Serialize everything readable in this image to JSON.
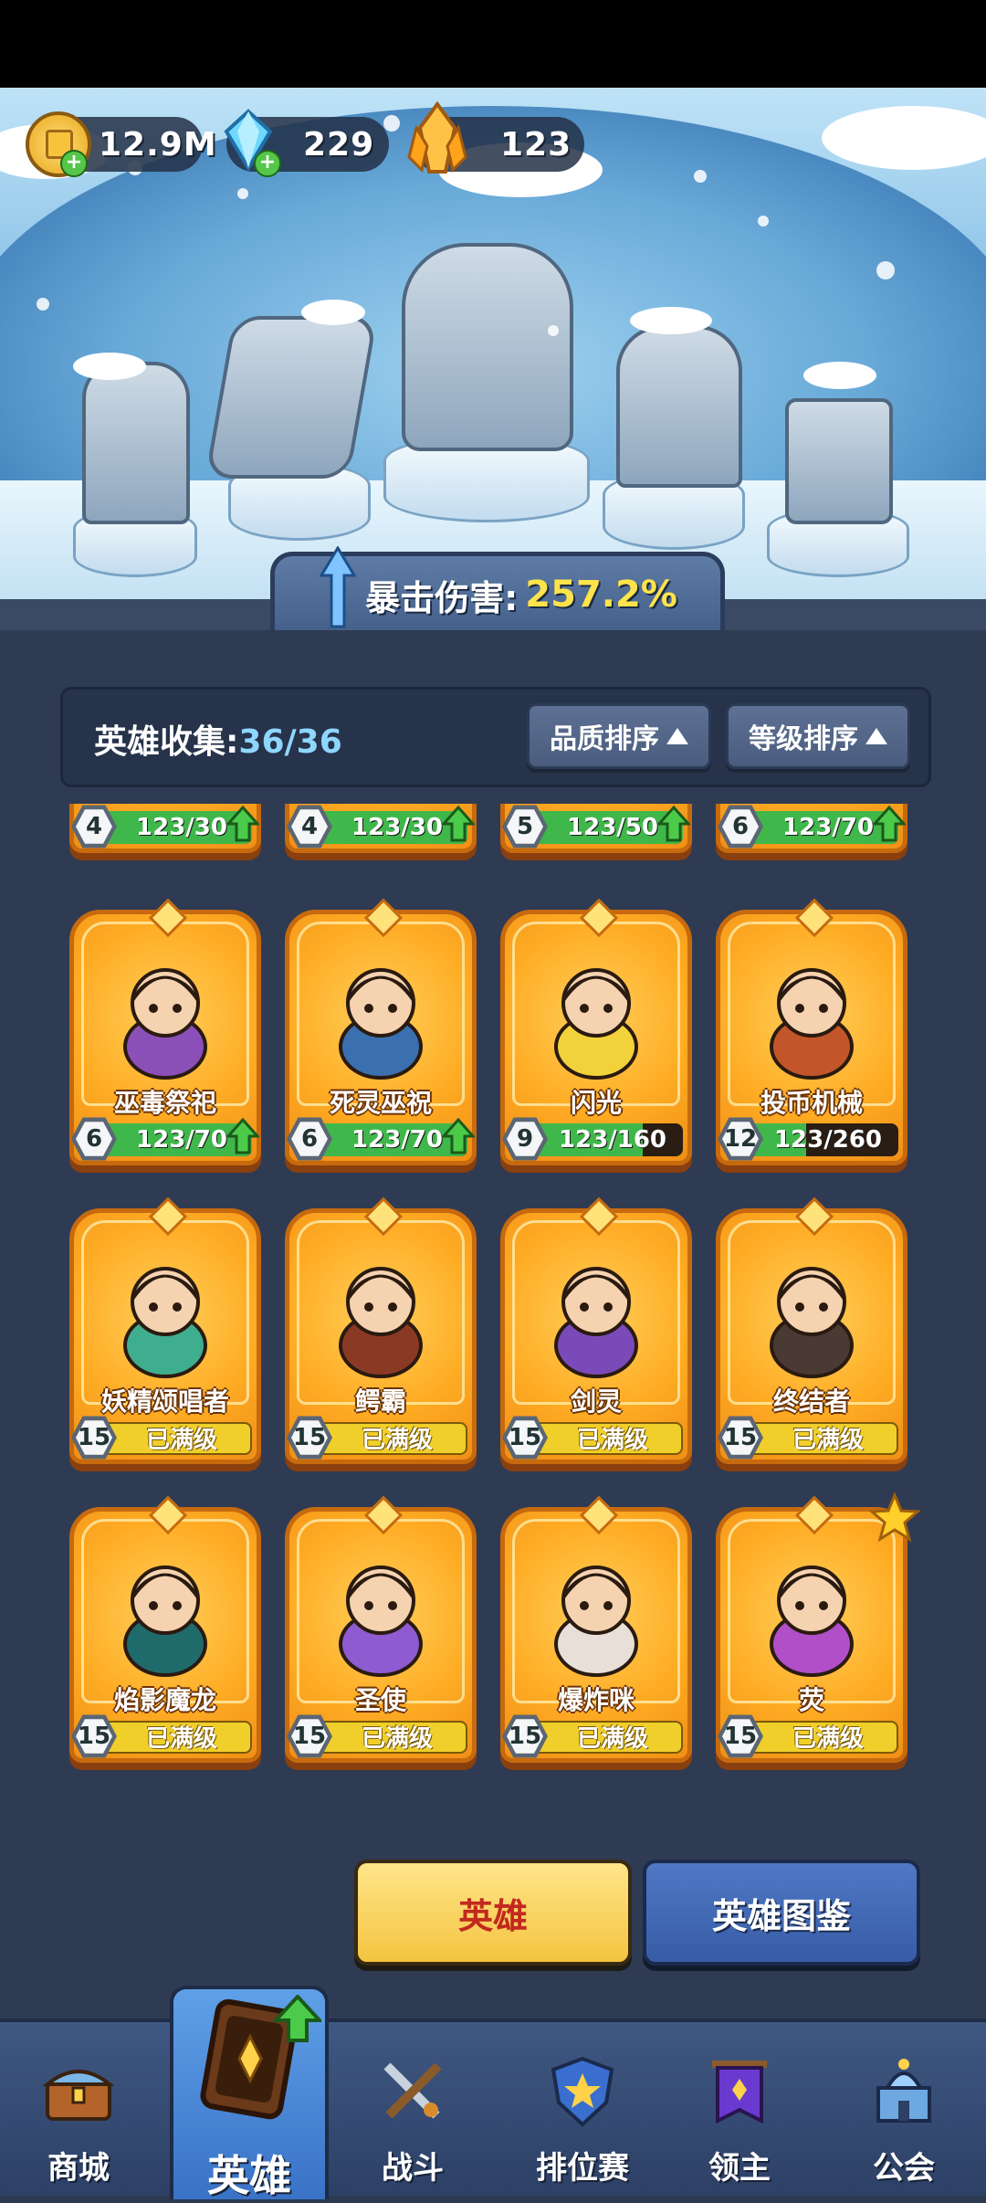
{
  "resources": {
    "gold": "12.9M",
    "diamonds": "229",
    "crystals": "123"
  },
  "crit_banner": {
    "label": "暴击伤害:",
    "value": "257.2%"
  },
  "collection": {
    "label": "英雄收集:",
    "count": "36/36",
    "sort_quality": "品质排序",
    "sort_level": "等级排序"
  },
  "heroes_partial": [
    {
      "level": "4",
      "progress": "123/30",
      "fill": 1.0
    },
    {
      "level": "4",
      "progress": "123/30",
      "fill": 1.0
    },
    {
      "level": "5",
      "progress": "123/50",
      "fill": 1.0
    },
    {
      "level": "6",
      "progress": "123/70",
      "fill": 1.0
    }
  ],
  "heroes": [
    {
      "name": "巫毒祭祀",
      "level": "6",
      "progress": "123/70",
      "fill": 1.0,
      "upgradable": true,
      "color": "#8b4fb8"
    },
    {
      "name": "死灵巫祝",
      "level": "6",
      "progress": "123/70",
      "fill": 1.0,
      "upgradable": true,
      "color": "#3a6fb0"
    },
    {
      "name": "闪光",
      "level": "9",
      "progress": "123/160",
      "fill": 0.77,
      "upgradable": false,
      "color": "#f2d23a"
    },
    {
      "name": "投币机械",
      "level": "12",
      "progress": "123/260",
      "fill": 0.47,
      "upgradable": false,
      "color": "#c2562a"
    },
    {
      "name": "妖精颂唱者",
      "level": "15",
      "progress": "已满级",
      "maxed": true,
      "color": "#3fae8e"
    },
    {
      "name": "鳄霸",
      "level": "15",
      "progress": "已满级",
      "maxed": true,
      "color": "#8a3a24"
    },
    {
      "name": "剑灵",
      "level": "15",
      "progress": "已满级",
      "maxed": true,
      "color": "#7a4bb8"
    },
    {
      "name": "终结者",
      "level": "15",
      "progress": "已满级",
      "maxed": true,
      "color": "#4a3a34"
    },
    {
      "name": "焰影魔龙",
      "level": "15",
      "progress": "已满级",
      "maxed": true,
      "color": "#1f6b6b"
    },
    {
      "name": "圣使",
      "level": "15",
      "progress": "已满级",
      "maxed": true,
      "color": "#8e5bd0"
    },
    {
      "name": "爆炸咪",
      "level": "15",
      "progress": "已满级",
      "maxed": true,
      "color": "#e8e0d8"
    },
    {
      "name": "荧",
      "level": "15",
      "progress": "已满级",
      "maxed": true,
      "color": "#b04fc8",
      "starred": true
    }
  ],
  "actions": {
    "heroes": "英雄",
    "codex": "英雄图鉴"
  },
  "nav": [
    {
      "label": "商城",
      "icon": "chest-icon"
    },
    {
      "label": "英雄",
      "icon": "hero-card-icon",
      "active": true
    },
    {
      "label": "战斗",
      "icon": "crossed-swords-icon"
    },
    {
      "label": "排位赛",
      "icon": "shield-emblem-icon"
    },
    {
      "label": "领主",
      "icon": "banner-icon"
    },
    {
      "label": "公会",
      "icon": "castle-icon"
    }
  ],
  "colors": {
    "accent_yellow": "#ffe34a",
    "card_orange": "#ffac24",
    "progress_green": "#3fb74a",
    "maxed_yellow": "#f0cf2a",
    "nav_blue": "#3f5882"
  }
}
